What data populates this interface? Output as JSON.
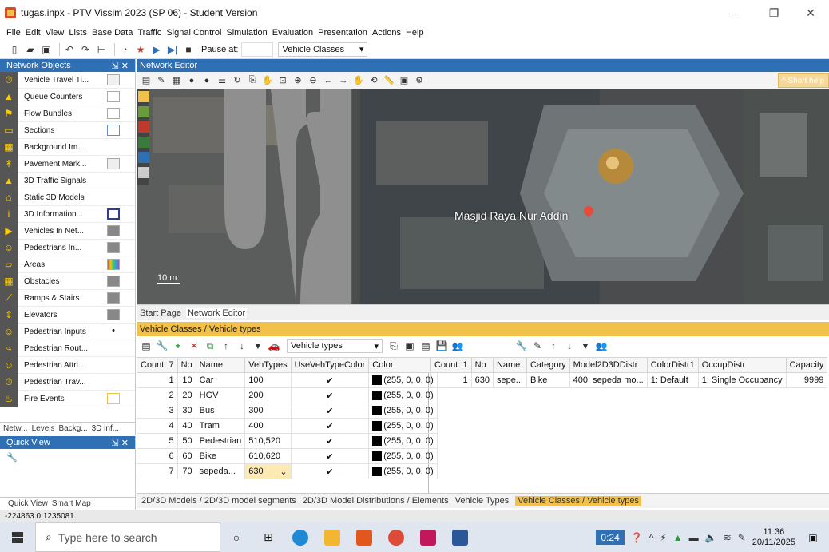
{
  "window": {
    "title": "tugas.inpx - PTV Vissim 2023 (SP 06) - Student Version",
    "controls": [
      "–",
      "❐",
      "✕"
    ]
  },
  "menu": [
    "File",
    "Edit",
    "View",
    "Lists",
    "Base Data",
    "Traffic",
    "Signal Control",
    "Simulation",
    "Evaluation",
    "Presentation",
    "Actions",
    "Help"
  ],
  "toolbar": {
    "pause_label": "Pause at:",
    "pause_value": "",
    "mode_value": "Vehicle Classes"
  },
  "network_objects": {
    "title": "Network Objects",
    "items": [
      {
        "label": "Vehicle Travel Ti...",
        "icon": "⏱"
      },
      {
        "label": "Queue Counters",
        "icon": "▲"
      },
      {
        "label": "Flow Bundles",
        "icon": "⚑"
      },
      {
        "label": "Sections",
        "icon": "▭"
      },
      {
        "label": "Background Im...",
        "icon": "▦"
      },
      {
        "label": "Pavement Mark...",
        "icon": "↟"
      },
      {
        "label": "3D Traffic Signals",
        "icon": "▲"
      },
      {
        "label": "Static 3D Models",
        "icon": "⌂"
      },
      {
        "label": "3D Information...",
        "icon": "i"
      },
      {
        "label": "Vehicles In Net...",
        "icon": "▶"
      },
      {
        "label": "Pedestrians In...",
        "icon": "☺"
      },
      {
        "label": "Areas",
        "icon": "▱"
      },
      {
        "label": "Obstacles",
        "icon": "▦"
      },
      {
        "label": "Ramps & Stairs",
        "icon": "⟋"
      },
      {
        "label": "Elevators",
        "icon": "⇕"
      },
      {
        "label": "Pedestrian Inputs",
        "icon": "☺"
      },
      {
        "label": "Pedestrian Rout...",
        "icon": "⤷"
      },
      {
        "label": "Pedestrian Attri...",
        "icon": "☺"
      },
      {
        "label": "Pedestrian Trav...",
        "icon": "⏱"
      },
      {
        "label": "Fire Events",
        "icon": "♨"
      }
    ],
    "tabs": [
      "Netw...",
      "Levels",
      "Backg...",
      "3D inf..."
    ]
  },
  "quick_view": {
    "title": "Quick View",
    "tabs": [
      "Quick View",
      "Smart Map"
    ]
  },
  "network_editor": {
    "title": "Network Editor",
    "short_help": "^ Short help",
    "map_label": "Masjid Raya Nur Addin",
    "scale_label": "10 m",
    "tabs": [
      "Start Page",
      "Network Editor"
    ]
  },
  "lists": {
    "title": "Vehicle Classes / Vehicle types",
    "left_select": "Vehicle types",
    "left_table": {
      "columns": [
        "Count: 7",
        "No",
        "Name",
        "VehTypes",
        "UseVehTypeColor",
        "Color"
      ],
      "rows": [
        {
          "idx": "1",
          "no": "10",
          "name": "Car",
          "vt": "100",
          "color": "(255, 0, 0, 0)"
        },
        {
          "idx": "2",
          "no": "20",
          "name": "HGV",
          "vt": "200",
          "color": "(255, 0, 0, 0)"
        },
        {
          "idx": "3",
          "no": "30",
          "name": "Bus",
          "vt": "300",
          "color": "(255, 0, 0, 0)"
        },
        {
          "idx": "4",
          "no": "40",
          "name": "Tram",
          "vt": "400",
          "color": "(255, 0, 0, 0)"
        },
        {
          "idx": "5",
          "no": "50",
          "name": "Pedestrian",
          "vt": "510,520",
          "color": "(255, 0, 0, 0)"
        },
        {
          "idx": "6",
          "no": "60",
          "name": "Bike",
          "vt": "610,620",
          "color": "(255, 0, 0, 0)"
        },
        {
          "idx": "7",
          "no": "70",
          "name": "sepeda...",
          "vt": "630",
          "color": "(255, 0, 0, 0)"
        }
      ]
    },
    "right_table": {
      "columns": [
        "Count: 1",
        "No",
        "Name",
        "Category",
        "Model2D3DDistr",
        "ColorDistr1",
        "OccupDistr",
        "Capacity"
      ],
      "rows": [
        {
          "idx": "1",
          "no": "630",
          "name": "sepe...",
          "category": "Bike",
          "model": "400: sepeda mo...",
          "color": "1: Default",
          "occup": "1: Single Occupancy",
          "capacity": "9999"
        }
      ]
    },
    "bottom_tabs": [
      "2D/3D Models / 2D/3D model segments",
      "2D/3D Model Distributions / Elements",
      "Vehicle Types",
      "Vehicle Classes / Vehicle types"
    ]
  },
  "status": {
    "coords": "-224863.0:1235081."
  },
  "taskbar": {
    "search_placeholder": "Type here to search",
    "time_badge": "0:24",
    "clock_time": "11:36",
    "clock_date": "20/11/2025"
  }
}
